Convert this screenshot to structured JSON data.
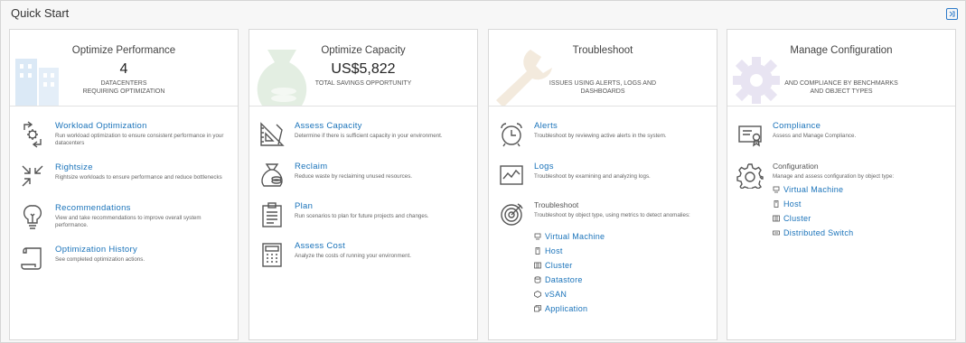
{
  "page": {
    "title": "Quick Start"
  },
  "cards": [
    {
      "title": "Optimize Performance",
      "value": "4",
      "subtitle_line1": "DATACENTERS",
      "subtitle_line2": "REQUIRING OPTIMIZATION",
      "items": [
        {
          "title": "Workload Optimization",
          "desc": "Run workload optimization to ensure consistent performance in your datacenters"
        },
        {
          "title": "Rightsize",
          "desc": "Rightsize workloads to ensure performance and reduce bottlenecks"
        },
        {
          "title": "Recommendations",
          "desc": "View and take recommendations to improve overall system performance."
        },
        {
          "title": "Optimization History",
          "desc": "See completed optimization actions."
        }
      ]
    },
    {
      "title": "Optimize Capacity",
      "value": "US$5,822",
      "subtitle_line1": "TOTAL SAVINGS OPPORTUNITY",
      "items": [
        {
          "title": "Assess Capacity",
          "desc": "Determine if there is sufficient capacity in your environment."
        },
        {
          "title": "Reclaim",
          "desc": "Reduce waste by reclaiming unused resources."
        },
        {
          "title": "Plan",
          "desc": "Run scenarios to plan for future projects and changes."
        },
        {
          "title": "Assess Cost",
          "desc": "Analyze the costs of running your environment."
        }
      ]
    },
    {
      "title": "Troubleshoot",
      "subtitle_line1": "ISSUES USING ALERTS, LOGS AND",
      "subtitle_line2": "DASHBOARDS",
      "items": [
        {
          "title": "Alerts",
          "desc": "Troubleshoot by reviewing active alerts in the system."
        },
        {
          "title": "Logs",
          "desc": "Troubleshoot by examining and analyzing logs."
        },
        {
          "title": "Troubleshoot",
          "desc": "Troubleshoot by object type, using metrics to detect anomalies:"
        }
      ],
      "links": [
        "Virtual Machine",
        "Host",
        "Cluster",
        "Datastore",
        "vSAN",
        "Application"
      ]
    },
    {
      "title": "Manage Configuration",
      "subtitle_line1": "AND COMPLIANCE BY BENCHMARKS",
      "subtitle_line2": "AND OBJECT TYPES",
      "items": [
        {
          "title": "Compliance",
          "desc": "Assess and Manage Compliance."
        },
        {
          "title": "Configuration",
          "desc": "Manage and assess configuration by object type:"
        }
      ],
      "links": [
        "Virtual Machine",
        "Host",
        "Cluster",
        "Distributed Switch"
      ]
    }
  ],
  "icons": {
    "expand": "expand-icon",
    "illustration_colors": {
      "performance": "#dbe9f6",
      "capacity": "#e3eee2",
      "troubleshoot": "#f3eadd",
      "configuration": "#e8e4f2"
    }
  }
}
